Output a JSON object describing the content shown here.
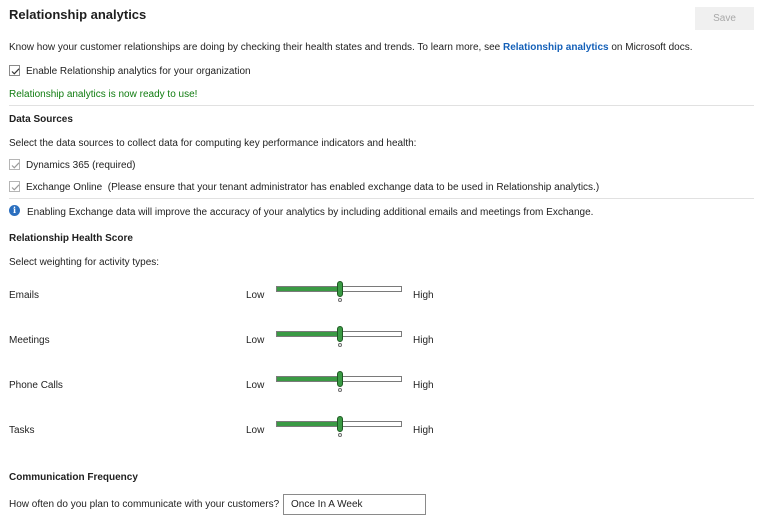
{
  "header": {
    "title": "Relationship analytics",
    "save_label": "Save"
  },
  "intro": {
    "text_before": "Know how your customer relationships are doing by checking their health states and trends. To learn more, see ",
    "link_text": "Relationship analytics",
    "text_after": " on Microsoft docs."
  },
  "enable": {
    "label": "Enable Relationship analytics for your organization",
    "checked": true
  },
  "status_message": "Relationship analytics is now ready to use!",
  "data_sources": {
    "heading": "Data Sources",
    "description": "Select the data sources to collect data for computing key performance indicators and health:",
    "dynamics_label": "Dynamics 365 (required)",
    "exchange_label": "Exchange Online",
    "exchange_note": "(Please ensure that your tenant administrator has enabled exchange data to be used in Relationship analytics.)",
    "info_text": "Enabling Exchange data will improve the accuracy of your analytics by including additional emails and meetings from Exchange."
  },
  "health_score": {
    "heading": "Relationship Health Score",
    "description": "Select weighting for activity types:",
    "low_label": "Low",
    "high_label": "High",
    "activities": [
      {
        "label": "Emails",
        "weight_fraction": 0.5
      },
      {
        "label": "Meetings",
        "weight_fraction": 0.5
      },
      {
        "label": "Phone Calls",
        "weight_fraction": 0.5
      },
      {
        "label": "Tasks",
        "weight_fraction": 0.5
      }
    ]
  },
  "communication": {
    "heading": "Communication Frequency",
    "question": "How often do you plan to communicate with your customers?",
    "value": "Once In A Week"
  },
  "colors": {
    "accent_green": "#3a9a44",
    "success_text": "#107c10",
    "link_blue": "#1460b8",
    "info_blue": "#2b6fbf"
  }
}
